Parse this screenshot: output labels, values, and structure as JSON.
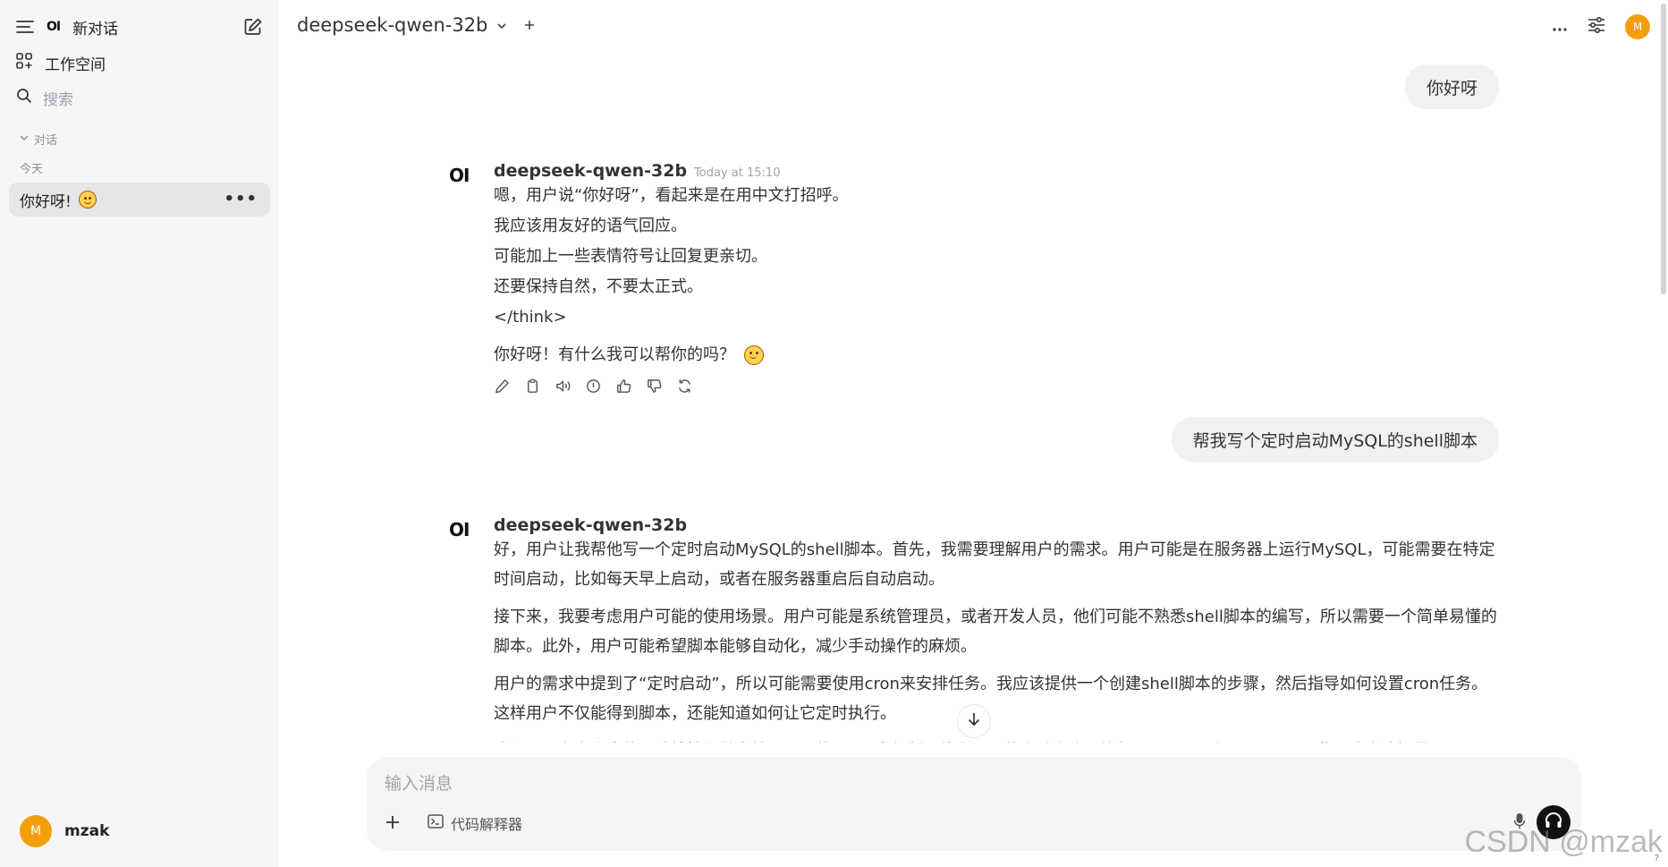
{
  "sidebar": {
    "logo_text": "OI",
    "new_chat_label": "新对话",
    "workspace_label": "工作空间",
    "search_placeholder": "搜索",
    "section_label": "对话",
    "group_today": "今天",
    "chats": [
      {
        "title": "你好呀!"
      }
    ],
    "user": {
      "avatar_initial": "M",
      "name": "mzak"
    }
  },
  "header": {
    "model_name": "deepseek-qwen-32b",
    "avatar_initial": "M"
  },
  "messages": [
    {
      "role": "user",
      "text": "你好呀"
    },
    {
      "role": "assistant",
      "logo": "OI",
      "model": "deepseek-qwen-32b",
      "time": "Today at 15:10",
      "lines": [
        "嗯，用户说“你好呀”，看起来是在用中文打招呼。",
        "我应该用友好的语气回应。",
        "可能加上一些表情符号让回复更亲切。",
        "还要保持自然，不要太正式。",
        "</think>"
      ],
      "reply": "你好呀！有什么我可以帮你的吗？"
    },
    {
      "role": "user",
      "text": "帮我写个定时启动MySQL的shell脚本"
    },
    {
      "role": "assistant",
      "logo": "OI",
      "model": "deepseek-qwen-32b",
      "paragraphs": [
        "好，用户让我帮他写一个定时启动MySQL的shell脚本。首先，我需要理解用户的需求。用户可能是在服务器上运行MySQL，可能需要在特定时间启动，比如每天早上启动，或者在服务器重启后自动启动。",
        "接下来，我要考虑用户可能的使用场景。用户可能是系统管理员，或者开发人员，他们可能不熟悉shell脚本的编写，所以需要一个简单易懂的脚本。此外，用户可能希望脚本能够自动化，减少手动操作的麻烦。",
        "用户的需求中提到了“定时启动”，所以可能需要使用cron来安排任务。我应该提供一个创建shell脚本的步骤，然后指导如何设置cron任务。这样用户不仅能得到脚本，还能知道如何让它定时执行。",
        "我还需要考虑脚本的可移植性和兼容性。不同的Linux发行版可能有不同的启动命令，比如systemctl和service。因此，我应该提供"
      ]
    }
  ],
  "composer": {
    "placeholder": "输入消息",
    "tool_label": "代码解释器"
  },
  "watermark": "CSDN @mzak",
  "help": "?"
}
